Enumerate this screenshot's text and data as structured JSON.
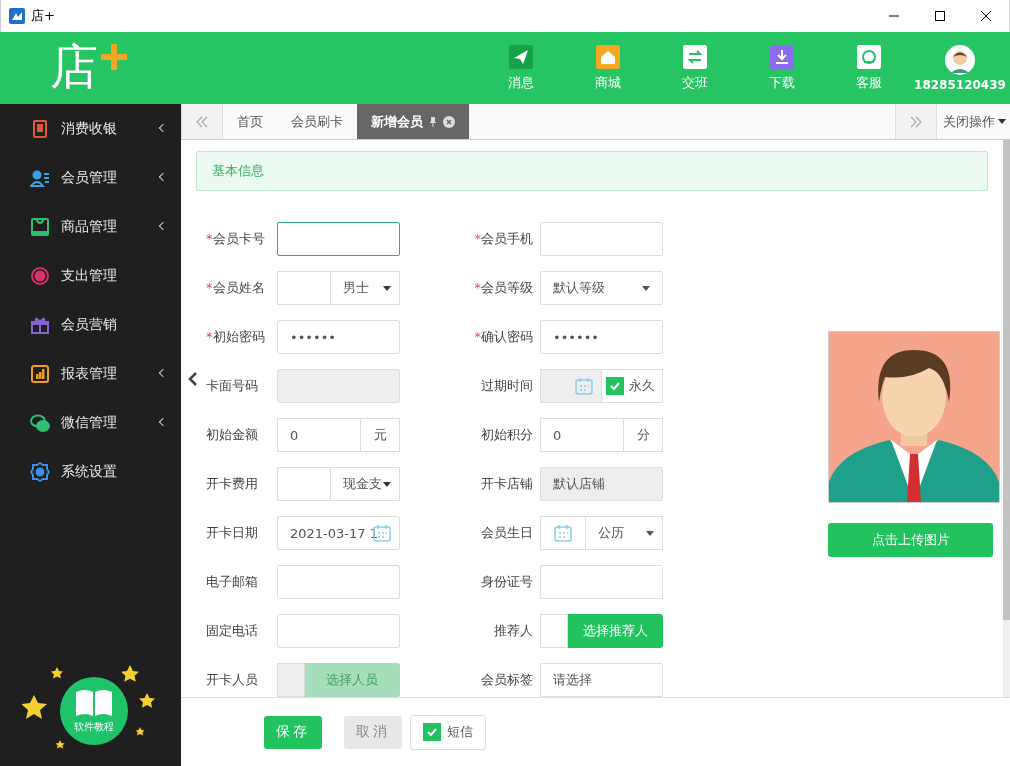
{
  "window": {
    "title": "店+"
  },
  "header": {
    "logo": "店",
    "nav": [
      {
        "label": "消息",
        "kind": "message"
      },
      {
        "label": "商城",
        "kind": "shop"
      },
      {
        "label": "交班",
        "kind": "shift"
      },
      {
        "label": "下载",
        "kind": "download"
      },
      {
        "label": "客服",
        "kind": "service"
      }
    ],
    "user": "18285120439"
  },
  "sidebar": {
    "items": [
      {
        "label": "消费收银",
        "kind": "cash",
        "color": "#e05a3a",
        "expandable": true
      },
      {
        "label": "会员管理",
        "kind": "member",
        "color": "#3a9ee0",
        "expandable": true
      },
      {
        "label": "商品管理",
        "kind": "goods",
        "color": "#2fbf71",
        "expandable": true
      },
      {
        "label": "支出管理",
        "kind": "expense",
        "color": "#d6336c",
        "expandable": false
      },
      {
        "label": "会员营销",
        "kind": "gift",
        "color": "#8a63d2",
        "expandable": false
      },
      {
        "label": "报表管理",
        "kind": "report",
        "color": "#f0a020",
        "expandable": true
      },
      {
        "label": "微信管理",
        "kind": "wechat",
        "color": "#2fbf71",
        "expandable": true
      },
      {
        "label": "系统设置",
        "kind": "settings",
        "color": "#3a8ee0",
        "expandable": false
      }
    ],
    "tutorial": "软件教程"
  },
  "tabs": [
    {
      "label": "首页",
      "selected": false,
      "pinned": false
    },
    {
      "label": "会员刷卡",
      "selected": false,
      "pinned": false
    },
    {
      "label": "新增会员",
      "selected": true,
      "pinned": true
    }
  ],
  "close_menu": "关闭操作",
  "section_title": "基本信息",
  "form_rows": [
    [
      {
        "label": "会员卡号",
        "required_mark": "*",
        "focused": true,
        "kind": "input"
      },
      {
        "label": "会员手机",
        "required_mark": "*",
        "focused": false,
        "kind": "input"
      }
    ],
    [
      {
        "label": "会员姓名",
        "required_mark": "*",
        "focused": false,
        "kind": "input-select",
        "option": "男士"
      },
      {
        "label": "会员等级",
        "required_mark": "*",
        "focused": false,
        "kind": "select",
        "option": "默认等级"
      }
    ],
    [
      {
        "label": "初始密码",
        "required_mark": "*",
        "focused": false,
        "kind": "input",
        "value": "••••••"
      },
      {
        "label": "确认密码",
        "required_mark": "*",
        "focused": false,
        "kind": "input",
        "value": "••••••"
      }
    ],
    [
      {
        "label": "卡面号码",
        "focused": false,
        "kind": "disabled"
      },
      {
        "label": "过期时间",
        "focused": false,
        "kind": "date-check",
        "check_label": "永久",
        "checked": true
      }
    ],
    [
      {
        "label": "初始金额",
        "focused": false,
        "kind": "addon",
        "value": "0",
        "addon": "元"
      },
      {
        "label": "初始积分",
        "focused": false,
        "kind": "addon",
        "value": "0",
        "addon": "分"
      }
    ],
    [
      {
        "label": "开卡费用",
        "focused": false,
        "kind": "input-select",
        "option": "现金支"
      },
      {
        "label": "开卡店铺",
        "focused": false,
        "kind": "disabled",
        "value": "默认店铺"
      }
    ],
    [
      {
        "label": "开卡日期",
        "focused": false,
        "kind": "date",
        "value": "2021-03-17 1"
      },
      {
        "label": "会员生日",
        "focused": false,
        "kind": "date-select",
        "option": "公历"
      }
    ],
    [
      {
        "label": "电子邮箱",
        "focused": false,
        "kind": "input"
      },
      {
        "label": "身份证号",
        "focused": false,
        "kind": "input"
      }
    ],
    [
      {
        "label": "固定电话",
        "focused": false,
        "kind": "input"
      },
      {
        "label": "推荐人",
        "focused": false,
        "kind": "picker",
        "button": "选择推荐人",
        "disabled": false
      }
    ],
    [
      {
        "label": "开卡人员",
        "focused": false,
        "kind": "picker",
        "button": "选择人员",
        "disabled": true
      },
      {
        "label": "会员标签",
        "focused": false,
        "kind": "input",
        "placeholder": "请选择"
      }
    ]
  ],
  "upload_button": "点击上传图片",
  "footer": {
    "save": "保存",
    "cancel": "取消",
    "sms": {
      "label": "短信",
      "checked": true
    }
  }
}
